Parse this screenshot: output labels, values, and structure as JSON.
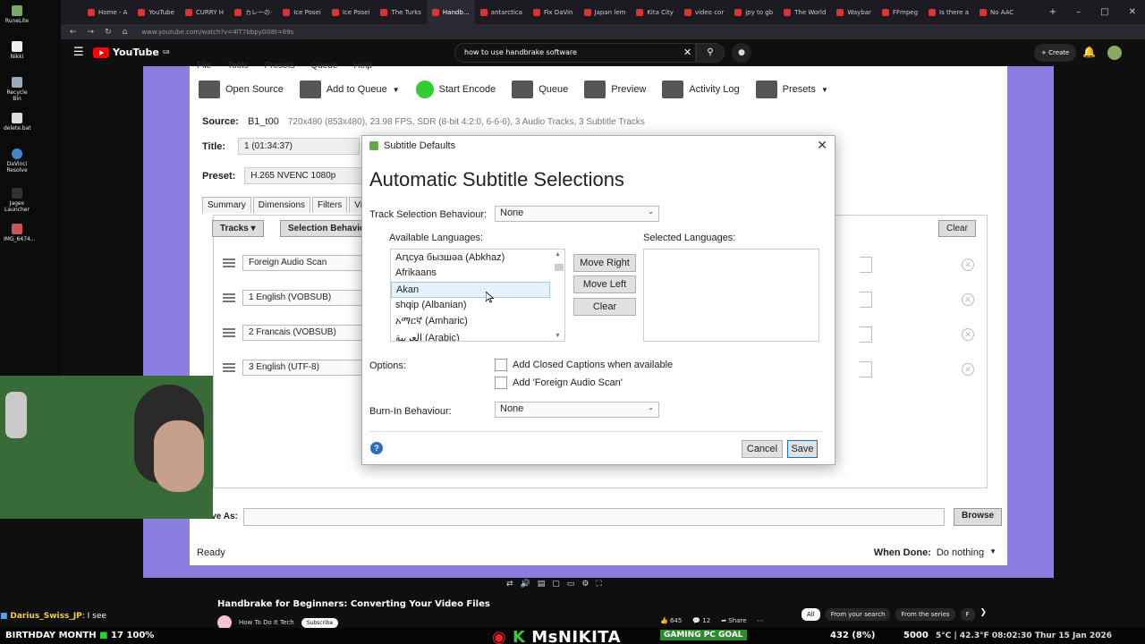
{
  "browser": {
    "tabs": [
      "Home - A",
      "YouTube",
      "CURRY H",
      "カレーの·",
      "Ice Posei",
      "Ice Posei",
      "The Turks",
      "Handb…",
      "antarctica",
      "Fix DaVin",
      "Japan lem",
      "Kita City",
      "video cor",
      "jpy to gb",
      "The World",
      "Waybar",
      "FFmpeg",
      "Is there a",
      "No AAC"
    ],
    "url": "www.youtube.com/watch?v=4lT7bbpyG08t=69s"
  },
  "desktop": {
    "icons": [
      "RuneLite",
      "Nikki",
      "Recycle Bin",
      "delete.bat",
      "DaVinci Resolve",
      "Jagex Launcher",
      "IMG_6474..."
    ]
  },
  "youtube": {
    "logo": "YouTube",
    "region": "GB",
    "search_value": "how to use handbrake software",
    "create_label": "Create",
    "video_title": "Handbrake for Beginners: Converting Your Video Files",
    "channel": "How To Do It Tech",
    "subscribe": "Subscribe",
    "likes": "645",
    "comments": "12",
    "share": "Share",
    "chips": [
      "All",
      "From your search",
      "From the series",
      "F"
    ]
  },
  "handbrake": {
    "menu": [
      "File",
      "Tools",
      "Presets",
      "Queue",
      "Help"
    ],
    "toolbar": {
      "open_source": "Open Source",
      "add_to_queue": "Add to Queue",
      "start_encode": "Start Encode",
      "queue": "Queue",
      "preview": "Preview",
      "activity_log": "Activity Log",
      "presets": "Presets"
    },
    "source_label": "Source:",
    "source_value": "B1_t00",
    "source_info": "720x480 (853x480), 23.98 FPS, SDR (8-bit 4:2:0, 6-6-6), 3 Audio Tracks, 3 Subtitle Tracks",
    "title_label": "Title:",
    "title_value": "1  (01:34:37)",
    "preset_label": "Preset:",
    "preset_value": "H.265 NVENC 1080p",
    "tabs": [
      "Summary",
      "Dimensions",
      "Filters",
      "Video"
    ],
    "tracks_btn": "Tracks",
    "selection_btn": "Selection Behavio",
    "clear_btn": "Clear",
    "tracks": [
      "Foreign Audio Scan",
      "1 English (VOBSUB)",
      "2 Francais (VOBSUB)",
      "3 English (UTF-8)"
    ],
    "save_as": "Save As:",
    "browse": "Browse",
    "status": "Ready",
    "when_done_label": "When Done:",
    "when_done_value": "Do nothing"
  },
  "dialog": {
    "title": "Subtitle Defaults",
    "heading": "Automatic Subtitle Selections",
    "track_selection_label": "Track Selection Behaviour:",
    "track_selection_value": "None",
    "available_label": "Available Languages:",
    "selected_label": "Selected Languages:",
    "languages": [
      "Aԥсуа бызшәа (Abkhaz)",
      "Afrikaans",
      "Akan",
      "shqip (Albanian)",
      "አማርኛ (Amharic)",
      "العربية (Arabic)"
    ],
    "selected_language": "Akan",
    "move_right": "Move Right",
    "move_left": "Move Left",
    "clear": "Clear",
    "options_label": "Options:",
    "option_cc": "Add Closed Captions when available",
    "option_fas": "Add 'Foreign Audio Scan'",
    "burnin_label": "Burn-In Behaviour:",
    "burnin_value": "None",
    "cancel": "Cancel",
    "save": "Save",
    "help": "?"
  },
  "stream": {
    "chat_user": "Darius_Swiss_JP",
    "chat_text": ": I see",
    "birthday": "BIRTHDAY MONTH",
    "birthday_count": "17",
    "birthday_pct": "100%",
    "streamer": "MsNIKITA",
    "goal": "GAMING PC GOAL",
    "stat_a": "432 (8%)",
    "stat_b": "5000",
    "weather_time": "5°C | 42.3°F  08:02:30  Thur 15 Jan 2026"
  },
  "colors": {
    "video_bg": "#8a7ee0",
    "youtube_red": "#ff0000",
    "selection_highlight": "#e5f1fb"
  }
}
